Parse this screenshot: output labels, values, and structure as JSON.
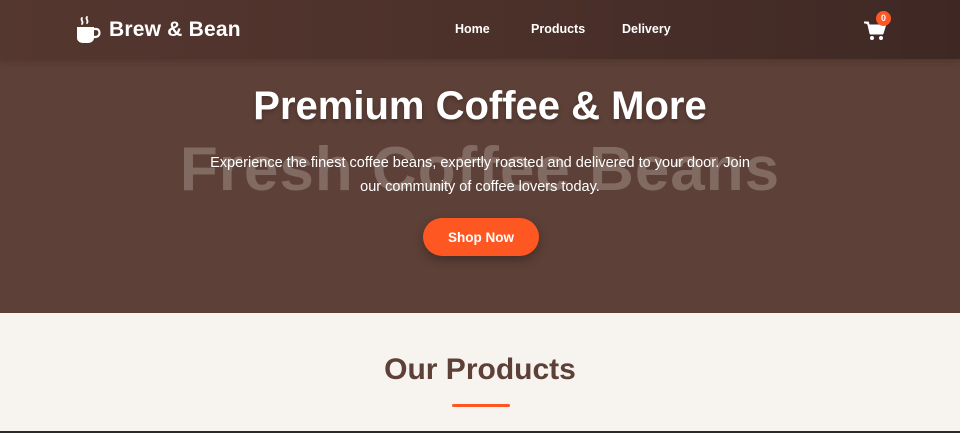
{
  "brand": {
    "name": "Brew & Bean",
    "icon": "coffee-cup-icon"
  },
  "nav": {
    "items": [
      {
        "label": "Home"
      },
      {
        "label": "Products"
      },
      {
        "label": "Delivery"
      }
    ],
    "cart_icon": "shopping-cart-icon",
    "cart_count": "0"
  },
  "hero": {
    "watermark": "Fresh Coffee Beans",
    "title": "Premium Coffee & More",
    "subtitle": "Experience the finest coffee beans, expertly roasted and delivered to your door. Join our community of coffee lovers today.",
    "cta_label": "Shop Now"
  },
  "products": {
    "title": "Our Products"
  },
  "colors": {
    "hero_bg": "#5d4037",
    "nav_bg": "#4b302a",
    "accent": "#ff5722",
    "section_bg": "#f7f3ee",
    "heading": "#5d4037"
  }
}
